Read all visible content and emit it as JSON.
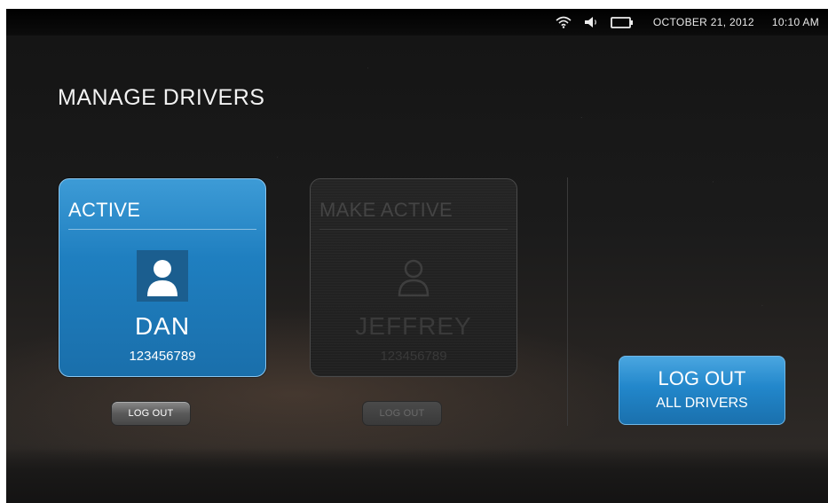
{
  "status_bar": {
    "wifi_icon": "wifi-icon",
    "volume_icon": "volume-icon",
    "battery_icon": "battery-icon",
    "date": "OCTOBER 21, 2012",
    "time": "10:10 AM"
  },
  "page": {
    "title": "MANAGE DRIVERS"
  },
  "drivers": [
    {
      "header": "ACTIVE",
      "avatar_icon": "user-avatar-icon",
      "name": "DAN",
      "id": "123456789",
      "logout_label": "LOG OUT",
      "state": "active"
    },
    {
      "header": "MAKE ACTIVE",
      "avatar_icon": "user-outline-icon",
      "name": "JEFFREY",
      "id": "123456789",
      "logout_label": "LOG OUT",
      "state": "inactive"
    }
  ],
  "logout_all": {
    "line1": "LOG OUT",
    "line2": "ALL DRIVERS"
  },
  "colors": {
    "accent_blue": "#1f7fc0",
    "background": "#1b1b1b"
  }
}
